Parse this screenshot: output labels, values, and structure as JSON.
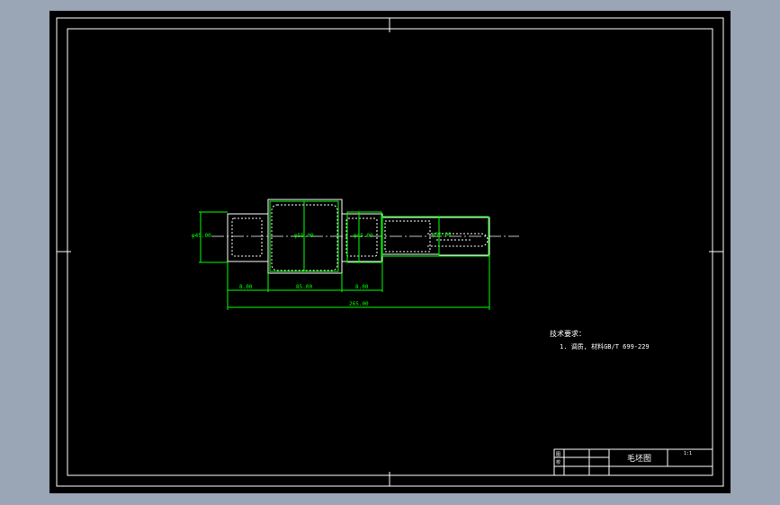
{
  "colors": {
    "canvas_bg": "#9aa5b5",
    "paper": "#000000",
    "border": "#ffffff",
    "part": "#ffffff",
    "dimension": "#00ff00",
    "centerline": "#ffffff"
  },
  "drawing": {
    "dimensions": {
      "dia_left": "φ45.00",
      "dia_mid": "φ55.00",
      "dia_right": "φ45.00",
      "dia_shaft": "φ32.00",
      "len_1": "8.00",
      "len_2": "85.00",
      "len_3": "8.00",
      "overall": "265.00"
    }
  },
  "notes": {
    "heading": "技术要求：",
    "line1": "1. 调质, 材料GB/T 699-229"
  },
  "title_block": {
    "title": "毛坯图",
    "scale": "1:1",
    "row1": "图",
    "row2": "校"
  }
}
